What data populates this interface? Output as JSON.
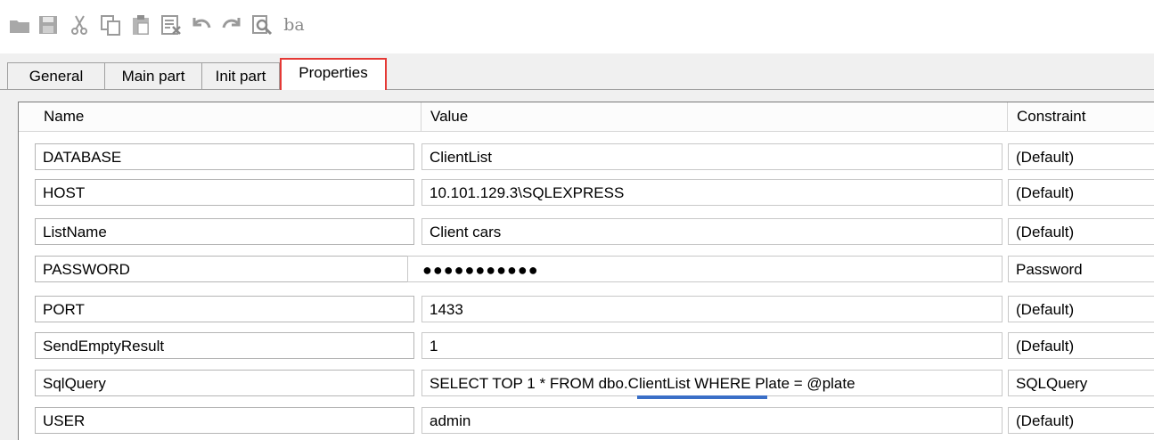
{
  "toolbar": {
    "icons": [
      "open-folder-icon",
      "save-icon",
      "cut-icon",
      "copy-icon",
      "paste-icon",
      "delete-icon",
      "undo-icon",
      "redo-icon",
      "find-icon",
      "replace-text-icon"
    ],
    "replace_text": "ba"
  },
  "tabs": [
    {
      "label": "General",
      "active": false
    },
    {
      "label": "Main part",
      "active": false
    },
    {
      "label": "Init part",
      "active": false
    },
    {
      "label": "Properties",
      "active": true
    }
  ],
  "table": {
    "columns": [
      "Name",
      "Value",
      "Constraint"
    ],
    "rows": [
      {
        "name": "DATABASE",
        "value": "ClientList",
        "constraint": "(Default)"
      },
      {
        "name": "HOST",
        "value": "10.101.129.3\\SQLEXPRESS",
        "constraint": "(Default)"
      },
      {
        "name": "ListName",
        "value": "Client cars",
        "constraint": "(Default)"
      },
      {
        "name": "PASSWORD",
        "value": "●●●●●●●●●●●",
        "constraint": "Password"
      },
      {
        "name": "PORT",
        "value": "1433",
        "constraint": "(Default)"
      },
      {
        "name": "SendEmptyResult",
        "value": "1",
        "constraint": "(Default)"
      },
      {
        "name": "SqlQuery",
        "value": "SELECT TOP 1 * FROM dbo.ClientList WHERE Plate = @plate",
        "constraint": "SQLQuery"
      },
      {
        "name": "USER",
        "value": "admin",
        "constraint": "(Default)"
      }
    ]
  },
  "colors": {
    "active_tab_border": "#e53935",
    "highlight_underline": "#3a6fc7"
  }
}
